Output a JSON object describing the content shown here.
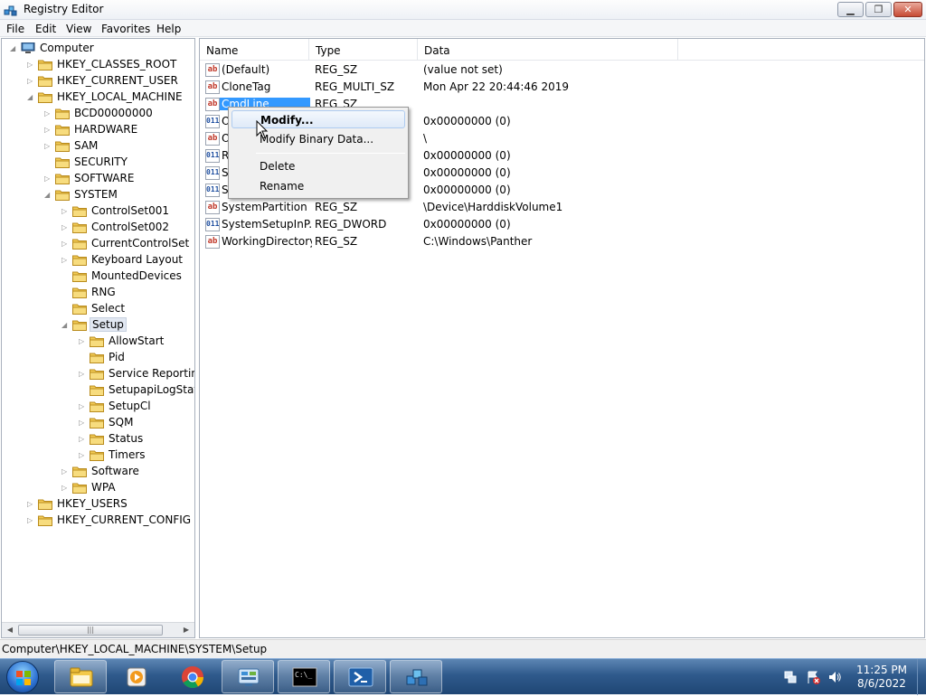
{
  "window": {
    "title": "Registry Editor",
    "controls": {
      "minimize": "▁",
      "maximize": "❐",
      "close": "✕"
    }
  },
  "menu": [
    "File",
    "Edit",
    "View",
    "Favorites",
    "Help"
  ],
  "tree": [
    {
      "label": "Computer",
      "level": 0,
      "expander": "open",
      "icon": "computer-icon"
    },
    {
      "label": "HKEY_CLASSES_ROOT",
      "level": 1,
      "expander": "closed",
      "icon": "folder-icon"
    },
    {
      "label": "HKEY_CURRENT_USER",
      "level": 1,
      "expander": "closed",
      "icon": "folder-icon"
    },
    {
      "label": "HKEY_LOCAL_MACHINE",
      "level": 1,
      "expander": "open",
      "icon": "folder-icon"
    },
    {
      "label": "BCD00000000",
      "level": 2,
      "expander": "closed",
      "icon": "folder-icon"
    },
    {
      "label": "HARDWARE",
      "level": 2,
      "expander": "closed",
      "icon": "folder-icon"
    },
    {
      "label": "SAM",
      "level": 2,
      "expander": "closed",
      "icon": "folder-icon"
    },
    {
      "label": "SECURITY",
      "level": 2,
      "expander": "none",
      "icon": "folder-icon"
    },
    {
      "label": "SOFTWARE",
      "level": 2,
      "expander": "closed",
      "icon": "folder-icon"
    },
    {
      "label": "SYSTEM",
      "level": 2,
      "expander": "open",
      "icon": "folder-icon"
    },
    {
      "label": "ControlSet001",
      "level": 3,
      "expander": "closed",
      "icon": "folder-icon"
    },
    {
      "label": "ControlSet002",
      "level": 3,
      "expander": "closed",
      "icon": "folder-icon"
    },
    {
      "label": "CurrentControlSet",
      "level": 3,
      "expander": "closed",
      "icon": "folder-icon"
    },
    {
      "label": "Keyboard Layout",
      "level": 3,
      "expander": "closed",
      "icon": "folder-icon"
    },
    {
      "label": "MountedDevices",
      "level": 3,
      "expander": "none",
      "icon": "folder-icon"
    },
    {
      "label": "RNG",
      "level": 3,
      "expander": "none",
      "icon": "folder-icon"
    },
    {
      "label": "Select",
      "level": 3,
      "expander": "none",
      "icon": "folder-icon"
    },
    {
      "label": "Setup",
      "level": 3,
      "expander": "open",
      "icon": "folder-icon",
      "selected": true
    },
    {
      "label": "AllowStart",
      "level": 4,
      "expander": "closed",
      "icon": "folder-icon"
    },
    {
      "label": "Pid",
      "level": 4,
      "expander": "none",
      "icon": "folder-icon"
    },
    {
      "label": "Service Reporting",
      "level": 4,
      "expander": "closed",
      "icon": "folder-icon"
    },
    {
      "label": "SetupapiLogStatu",
      "level": 4,
      "expander": "none",
      "icon": "folder-icon"
    },
    {
      "label": "SetupCl",
      "level": 4,
      "expander": "closed",
      "icon": "folder-icon"
    },
    {
      "label": "SQM",
      "level": 4,
      "expander": "closed",
      "icon": "folder-icon"
    },
    {
      "label": "Status",
      "level": 4,
      "expander": "closed",
      "icon": "folder-icon"
    },
    {
      "label": "Timers",
      "level": 4,
      "expander": "closed",
      "icon": "folder-icon"
    },
    {
      "label": "Software",
      "level": 3,
      "expander": "closed",
      "icon": "folder-icon"
    },
    {
      "label": "WPA",
      "level": 3,
      "expander": "closed",
      "icon": "folder-icon"
    },
    {
      "label": "HKEY_USERS",
      "level": 1,
      "expander": "closed",
      "icon": "folder-icon"
    },
    {
      "label": "HKEY_CURRENT_CONFIG",
      "level": 1,
      "expander": "closed",
      "icon": "folder-icon"
    }
  ],
  "tree_scroll": {
    "grip": "|||"
  },
  "list": {
    "columns": [
      "Name",
      "Type",
      "Data"
    ],
    "rows": [
      {
        "name": "(Default)",
        "type": "REG_SZ",
        "data": "(value not set)",
        "icon": "string-value-icon"
      },
      {
        "name": "CloneTag",
        "type": "REG_MULTI_SZ",
        "data": "Mon Apr 22 20:44:46 2019",
        "icon": "string-value-icon"
      },
      {
        "name": "CmdLine",
        "type": "REG_SZ",
        "data": "",
        "icon": "string-value-icon",
        "selected": true
      },
      {
        "name": "O",
        "type": "",
        "data": "0x00000000 (0)",
        "icon": "binary-value-icon"
      },
      {
        "name": "O",
        "type": "",
        "data": "\\",
        "icon": "string-value-icon"
      },
      {
        "name": "R",
        "type": "",
        "data": "0x00000000 (0)",
        "icon": "binary-value-icon"
      },
      {
        "name": "S",
        "type": "",
        "data": "0x00000000 (0)",
        "icon": "binary-value-icon"
      },
      {
        "name": "S",
        "type": "",
        "data": "0x00000000 (0)",
        "icon": "binary-value-icon"
      },
      {
        "name": "SystemPartition",
        "type": "REG_SZ",
        "data": "\\Device\\HarddiskVolume1",
        "icon": "string-value-icon"
      },
      {
        "name": "SystemSetupInP...",
        "type": "REG_DWORD",
        "data": "0x00000000 (0)",
        "icon": "binary-value-icon"
      },
      {
        "name": "WorkingDirectory",
        "type": "REG_SZ",
        "data": "C:\\Windows\\Panther",
        "icon": "string-value-icon"
      }
    ]
  },
  "context_menu": {
    "items": [
      "Modify...",
      "Modify Binary Data...",
      "Delete",
      "Rename"
    ]
  },
  "icon_glyphs": {
    "string": "ab",
    "binary": "011"
  },
  "status": {
    "path": "Computer\\HKEY_LOCAL_MACHINE\\SYSTEM\\Setup"
  },
  "taskbar": {
    "apps": [
      "file-explorer-icon",
      "media-player-icon",
      "chrome-icon",
      "control-panel-icon",
      "command-prompt-icon",
      "powershell-icon",
      "registry-editor-icon"
    ],
    "cmd_glyph": "C:\\_",
    "clock": {
      "time": "11:25 PM",
      "date": "8/6/2022"
    }
  },
  "colors": {
    "selection": "#3399ff",
    "taskbar": "#2f5a8c",
    "menu_highlight": "#dfeaf8"
  }
}
